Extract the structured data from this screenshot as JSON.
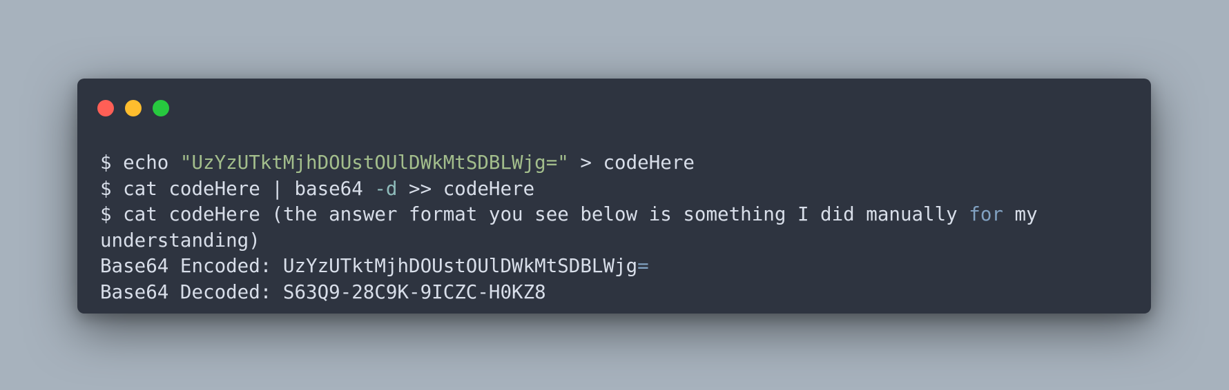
{
  "window": {
    "controls": {
      "close_color": "#ff5f56",
      "minimize_color": "#ffbd2e",
      "maximize_color": "#27c93f"
    }
  },
  "terminal": {
    "line1": {
      "prompt": "$ echo ",
      "string": "\"UzYzUTktMjhDOUstOUlDWkMtSDBLWjg=\"",
      "rest": " > codeHere"
    },
    "line2": {
      "prefix": "$ cat codeHere | base64 ",
      "flag": "-d",
      "rest": " >> codeHere"
    },
    "line3": {
      "prefix": "$ cat codeHere (the answer format you see below is something I did manually ",
      "keyword": "for",
      "rest": " my"
    },
    "line4": "understanding)",
    "line5": {
      "label": "Base64 Encoded: UzYzUTktMjhDOUstOUlDWkMtSDBLWjg",
      "suffix": "="
    },
    "line6": "Base64 Decoded: S63Q9-28C9K-9ICZC-H0KZ8"
  },
  "colors": {
    "background": "#a7b2bd",
    "window_bg": "#2e3440",
    "text": "#d8dee9",
    "string": "#a3be8c",
    "flag": "#8fbcbb",
    "keyword": "#81a1c1"
  }
}
